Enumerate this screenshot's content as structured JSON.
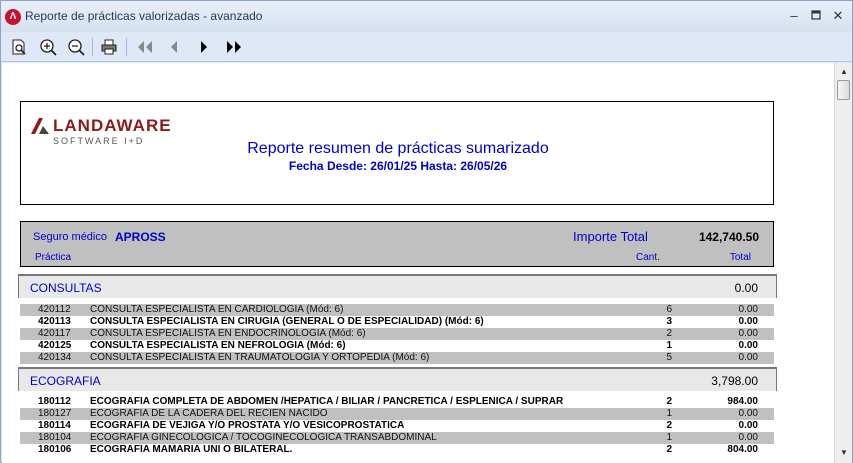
{
  "window": {
    "title": "Reporte de prácticas valorizadas - avanzado",
    "icon": "app-logo-icon",
    "controls": [
      "minimize-icon",
      "maximize-icon",
      "close-icon"
    ]
  },
  "toolbar": {
    "buttons": [
      "print-preview-icon",
      "zoom-in-icon",
      "zoom-out-icon",
      "printer-icon",
      "first-page-icon",
      "previous-page-icon",
      "next-page-icon",
      "last-page-icon"
    ]
  },
  "report": {
    "logo": {
      "name": "LANDAWARE",
      "tagline": "SOFTWARE I+D"
    },
    "title": "Reporte resumen de prácticas sumarizado",
    "subtitle": "Fecha Desde: 26/01/25 Hasta: 26/05/26",
    "insurer": {
      "label": "Seguro médico",
      "value": "APROSS",
      "total_label": "Importe Total",
      "total_value": "142,740.50"
    },
    "columns": {
      "practice": "Práctica",
      "qty": "Cant.",
      "total": "Total"
    },
    "sections": [
      {
        "name": "CONSULTAS",
        "total": "0.00",
        "rows": [
          {
            "code": "420112",
            "desc": "CONSULTA ESPECIALISTA EN CARDIOLOGIA (Mód: 6)",
            "qty": "6",
            "total": "0.00",
            "bold": false
          },
          {
            "code": "420113",
            "desc": "CONSULTA ESPECIALISTA EN CIRUGIA (GENERAL O DE ESPECIALIDAD) (Mód: 6)",
            "qty": "3",
            "total": "0.00",
            "bold": true
          },
          {
            "code": "420117",
            "desc": "CONSULTA ESPECIALISTA EN ENDOCRINOLOGIA (Mód: 6)",
            "qty": "2",
            "total": "0.00",
            "bold": false
          },
          {
            "code": "420125",
            "desc": "CONSULTA ESPECIALISTA EN NEFROLOGIA (Mód: 6)",
            "qty": "1",
            "total": "0.00",
            "bold": true
          },
          {
            "code": "420134",
            "desc": "CONSULTA ESPECIALISTA EN TRAUMATOLOGIA Y ORTOPEDIA (Mód: 6)",
            "qty": "5",
            "total": "0.00",
            "bold": false
          }
        ]
      },
      {
        "name": "ECOGRAFIA",
        "total": "3,798.00",
        "rows": [
          {
            "code": "180112",
            "desc": "ECOGRAFIA COMPLETA DE ABDOMEN /HEPATICA / BILIAR / PANCRETICA / ESPLENICA / SUPRAR",
            "qty": "2",
            "total": "984.00",
            "bold": true
          },
          {
            "code": "180127",
            "desc": "ECOGRAFIA DE LA CADERA DEL RECIEN NACIDO",
            "qty": "1",
            "total": "0.00",
            "bold": false
          },
          {
            "code": "180114",
            "desc": "ECOGRAFIA DE VEJIGA Y/O PROSTATA Y/O VESICOPROSTATICA",
            "qty": "2",
            "total": "0.00",
            "bold": true
          },
          {
            "code": "180104",
            "desc": "ECOGRAFIA GINECOLOGICA / TOCOGINECOLOGICA TRANSABDOMINAL",
            "qty": "1",
            "total": "0.00",
            "bold": false
          },
          {
            "code": "180106",
            "desc": "ECOGRAFIA MAMARIA UNI O BILATERAL.",
            "qty": "2",
            "total": "804.00",
            "bold": true
          }
        ]
      }
    ]
  }
}
